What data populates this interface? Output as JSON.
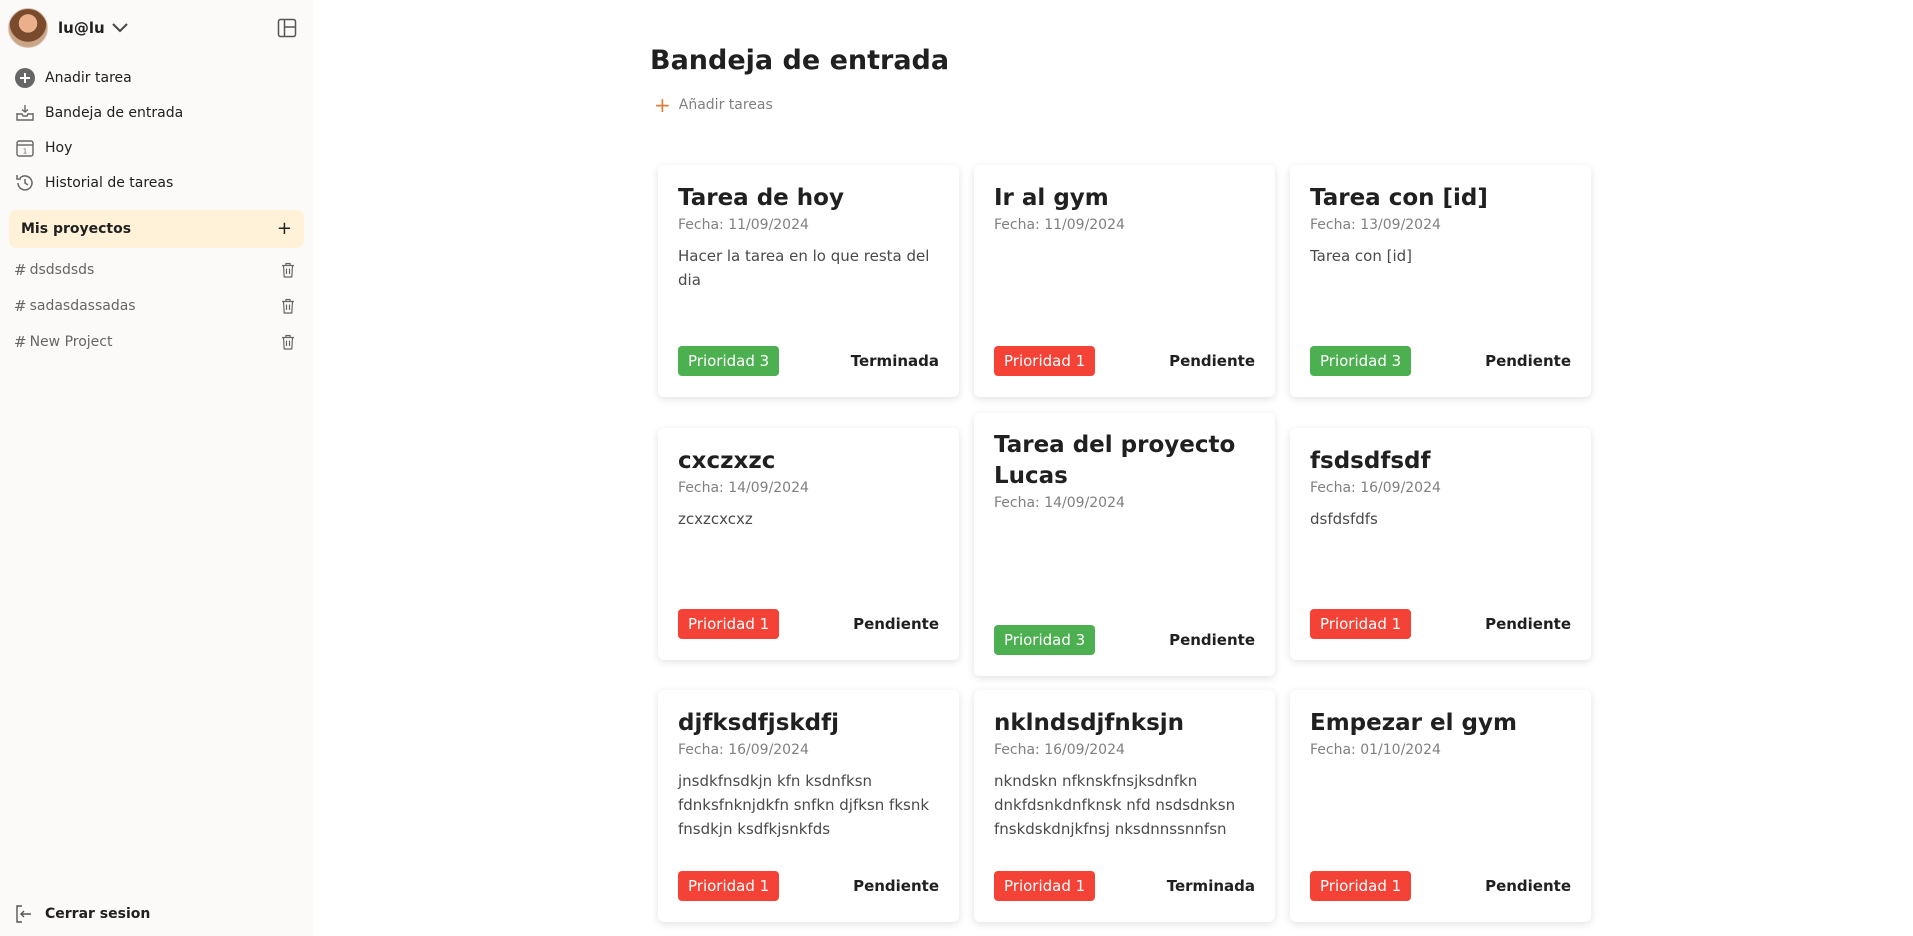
{
  "user": {
    "name": "lu@lu"
  },
  "nav": [
    {
      "label": "Anadir tarea",
      "icon": "plus-circle-icon"
    },
    {
      "label": "Bandeja de entrada",
      "icon": "inbox-icon"
    },
    {
      "label": "Hoy",
      "icon": "calendar-icon"
    },
    {
      "label": "Historial de tareas",
      "icon": "history-icon"
    }
  ],
  "projects": {
    "title": "Mis proyectos",
    "items": [
      {
        "label": "dsdsdsds"
      },
      {
        "label": "sadasdassadas"
      },
      {
        "label": "New Project"
      }
    ]
  },
  "logout_label": "Cerrar sesion",
  "main": {
    "title": "Bandeja de entrada",
    "add_label": "Añadir tareas"
  },
  "cards": [
    {
      "title": "Tarea de hoy",
      "date": "Fecha: 11/09/2024",
      "desc": "Hacer la tarea en lo que resta del dia",
      "priority": "Prioridad 3",
      "status": "Terminada"
    },
    {
      "title": "Ir al gym",
      "date": "Fecha: 11/09/2024",
      "desc": "",
      "priority": "Prioridad 1",
      "status": "Pendiente"
    },
    {
      "title": "Tarea con [id]",
      "date": "Fecha: 13/09/2024",
      "desc": "Tarea con [id]",
      "priority": "Prioridad 3",
      "status": "Pendiente"
    },
    {
      "title": "cxczxzc",
      "date": "Fecha: 14/09/2024",
      "desc": "zcxzcxcxz",
      "priority": "Prioridad 1",
      "status": "Pendiente"
    },
    {
      "title": "Tarea del proyecto Lucas",
      "date": "Fecha: 14/09/2024",
      "desc": "",
      "priority": "Prioridad 3",
      "status": "Pendiente"
    },
    {
      "title": "fsdsdfsdf",
      "date": "Fecha: 16/09/2024",
      "desc": "dsfdsfdfs",
      "priority": "Prioridad 1",
      "status": "Pendiente"
    },
    {
      "title": "djfksdfjskdfj",
      "date": "Fecha: 16/09/2024",
      "desc": "jnsdkfnsdkjn kfn ksdnfksn fdnksfnknjdkfn snfkn djfksn fksnk fnsdkjn ksdfkjsnkfds",
      "priority": "Prioridad 1",
      "status": "Pendiente"
    },
    {
      "title": "nklndsdjfnksjn",
      "date": "Fecha: 16/09/2024",
      "desc": "nkndskn nfknskfnsjksdnfkn dnkfdsnkdnfknsk nfd nsdsdnksn fnskdskdnjkfnsj nksdnnssnnfsn",
      "priority": "Prioridad 1",
      "status": "Terminada"
    },
    {
      "title": "Empezar el gym",
      "date": "Fecha: 01/10/2024",
      "desc": "",
      "priority": "Prioridad 1",
      "status": "Pendiente"
    }
  ],
  "colors": {
    "priority_1": "#f44336",
    "priority_3": "#4caf50",
    "accent": "#dd7d3b",
    "projects_bg": "#fff2d9"
  }
}
